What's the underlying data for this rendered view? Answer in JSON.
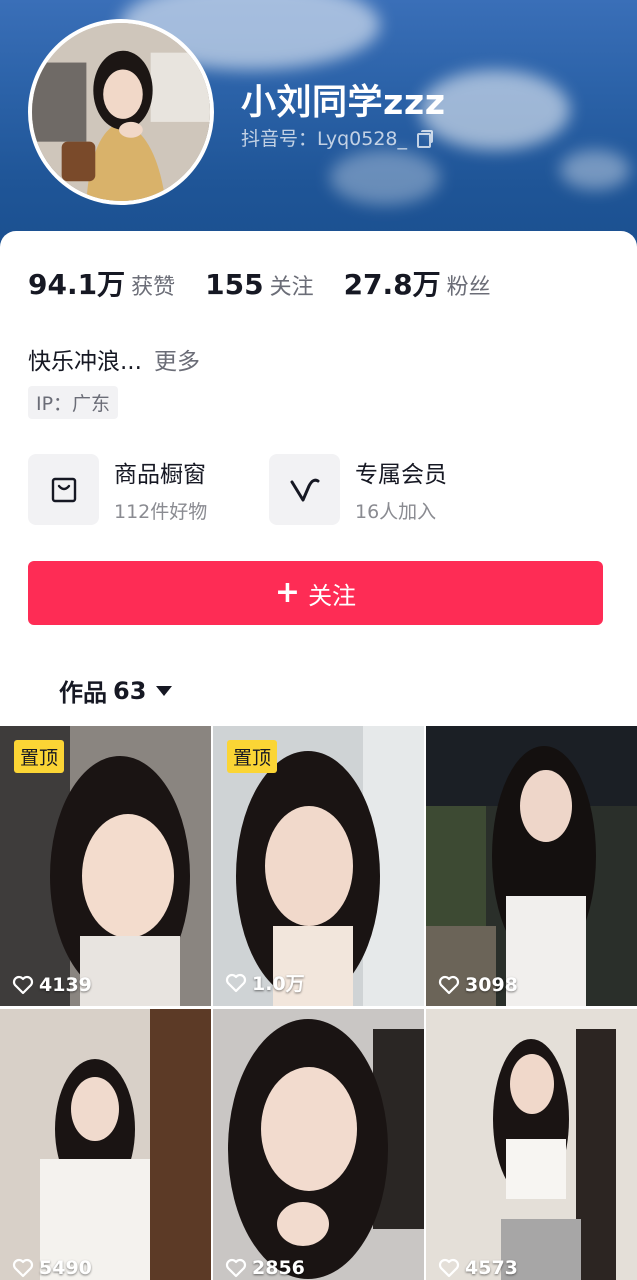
{
  "profile": {
    "nickname": "小刘同学zzz",
    "douyin_id": "抖音号：Lyq0528_",
    "bio": "快乐冲浪...",
    "bio_more": "更多",
    "ip": "IP：广东"
  },
  "stats": [
    {
      "num": "94.1万",
      "label": "获赞"
    },
    {
      "num": "155",
      "label": "关注"
    },
    {
      "num": "27.8万",
      "label": "粉丝"
    }
  ],
  "entries": {
    "shop": {
      "title": "商品橱窗",
      "sub": "112件好物",
      "icon": "shopping-bag-icon"
    },
    "member": {
      "title": "专属会员",
      "sub": "16人加入",
      "icon": "v-logo-icon"
    }
  },
  "follow_button": {
    "label": "关注",
    "color": "#fe2c55"
  },
  "works_tab": {
    "label": "作品",
    "count": "63"
  },
  "videos": [
    {
      "pinned": "置顶",
      "likes": "4139"
    },
    {
      "pinned": "置顶",
      "likes": "1.0万"
    },
    {
      "pinned": "",
      "likes": "3098"
    },
    {
      "pinned": "",
      "likes": "5490"
    },
    {
      "pinned": "",
      "likes": "2856"
    },
    {
      "pinned": "",
      "likes": "4573"
    }
  ],
  "colors": {
    "accent": "#fe2c55",
    "pin_badge": "#fbd535",
    "header_bg": "#2b62a8"
  }
}
